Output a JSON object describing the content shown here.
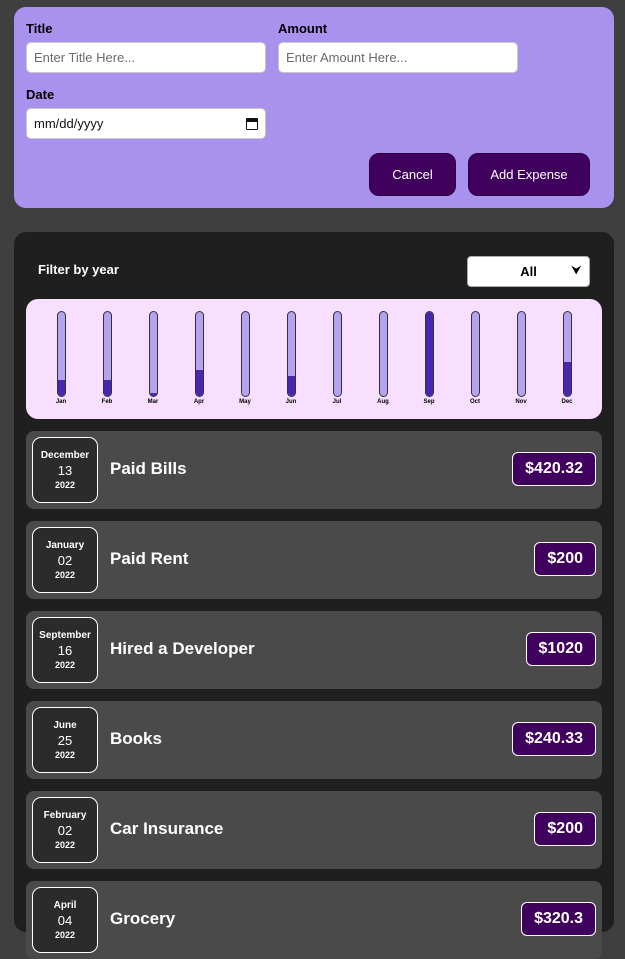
{
  "form": {
    "title_label": "Title",
    "title_placeholder": "Enter Title Here...",
    "amount_label": "Amount",
    "amount_placeholder": "Enter Amount Here...",
    "date_label": "Date",
    "date_placeholder": "mm/dd/yyyy",
    "cancel_label": "Cancel",
    "add_label": "Add Expense"
  },
  "filter": {
    "label": "Filter by year",
    "selected": "All"
  },
  "chart_data": {
    "type": "bar",
    "categories": [
      "Jan",
      "Feb",
      "Mar",
      "Apr",
      "May",
      "Jun",
      "Jul",
      "Aug",
      "Sep",
      "Oct",
      "Nov",
      "Dec"
    ],
    "values": [
      0.19,
      0.19,
      0.04,
      0.31,
      0.0,
      0.24,
      0.0,
      0.0,
      1.0,
      0.0,
      0.0,
      0.41
    ],
    "ylim": [
      0,
      1
    ]
  },
  "colors": {
    "accent": "#40005d",
    "form_bg": "#a892ee",
    "chart_bg": "#f8dfff",
    "bar_track": "#b3a3f0",
    "bar_fill": "#4826b0"
  },
  "expenses": [
    {
      "month": "December",
      "day": "13",
      "year": "2022",
      "title": "Paid Bills",
      "amount": "$420.32"
    },
    {
      "month": "January",
      "day": "02",
      "year": "2022",
      "title": "Paid Rent",
      "amount": "$200"
    },
    {
      "month": "September",
      "day": "16",
      "year": "2022",
      "title": "Hired a Developer",
      "amount": "$1020"
    },
    {
      "month": "June",
      "day": "25",
      "year": "2022",
      "title": "Books",
      "amount": "$240.33"
    },
    {
      "month": "February",
      "day": "02",
      "year": "2022",
      "title": "Car Insurance",
      "amount": "$200"
    },
    {
      "month": "April",
      "day": "04",
      "year": "2022",
      "title": "Grocery",
      "amount": "$320.3"
    }
  ]
}
